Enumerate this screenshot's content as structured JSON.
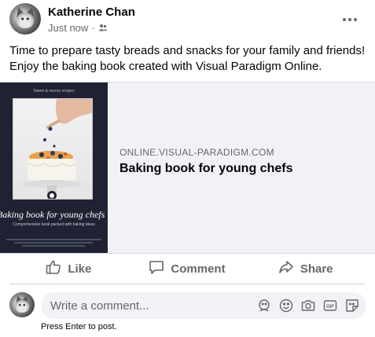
{
  "post": {
    "author": "Katherine Chan",
    "timestamp": "Just now",
    "audience_icon": "friends-icon",
    "text_line1": "Time to prepare tasty breads and snacks for your family and friends!",
    "text_line2": "Enjoy the baking book created with Visual Paradigm Online."
  },
  "link_preview": {
    "domain": "ONLINE.VISUAL-PARADIGM.COM",
    "title": "Baking book for young chefs",
    "cover": {
      "top_label": "Sweet & savory recipes",
      "title": "Baking book for young chefs",
      "subtitle": "Comprehensive book packed with baking ideas"
    }
  },
  "actions": {
    "like": "Like",
    "comment": "Comment",
    "share": "Share"
  },
  "comment_composer": {
    "placeholder": "Write a comment...",
    "hint": "Press Enter to post.",
    "icons": [
      "avatar-sticker-icon",
      "emoji-icon",
      "camera-icon",
      "gif-icon",
      "sticker-icon"
    ]
  },
  "colors": {
    "secondary_text": "#65676b",
    "card_bg": "#f0f2f5",
    "cover_bg": "#1e2233"
  }
}
